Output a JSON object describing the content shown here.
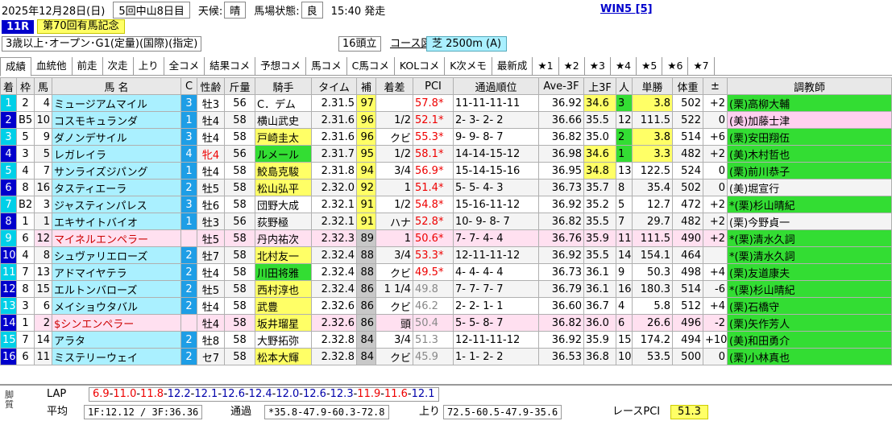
{
  "header": {
    "date": "2025年12月28日(日)",
    "meeting": "5回中山8日目",
    "weather_label": "天候:",
    "weather": "晴",
    "track_label": "馬場状態:",
    "track": "良",
    "start": "15:40 発走",
    "win5": "WIN5 [5]",
    "race_no": "11R",
    "race_name": "第70回有馬記念",
    "condition": "3歳以上･オープン･G1(定量)(国際)(指定)",
    "heads": "16頭立",
    "course_map": "コース図",
    "distance": "芝 2500m (A)"
  },
  "tabs": [
    "成績",
    "血統他",
    "前走",
    "次走",
    "上り",
    "全コメ",
    "結果コメ",
    "予想コメ",
    "馬コメ",
    "C馬コメ",
    "KOLコメ",
    "K次メモ",
    "最新成",
    "★1",
    "★2",
    "★3",
    "★4",
    "★5",
    "★6",
    "★7"
  ],
  "columns": [
    "着",
    "枠",
    "馬",
    "馬 名",
    "C",
    "性齢",
    "斤量",
    "騎手",
    "タイム",
    "補",
    "着差",
    "PCI",
    "通過順位",
    "Ave-3F",
    "上3F",
    "人",
    "単勝",
    "体重",
    "±",
    "調教師"
  ],
  "rows": [
    {
      "pos": "1",
      "waku": "2",
      "no": "4",
      "name": "ミュージアムマイル",
      "c": "3",
      "sa": "牡3",
      "kin": "56",
      "jockey": "C．デム",
      "time": "2.31.5",
      "ho": "97",
      "diff": "",
      "pci": "57.8*",
      "pass": "11-11-11-11",
      "ave": "36.92",
      "f3": "34.6",
      "pop": "3",
      "odds": "3.8",
      "wt": "502",
      "pm": "+2",
      "trainer": "(栗)高柳大輔"
    },
    {
      "pos": "2",
      "waku": "B5",
      "no": "10",
      "name": "コスモキュランダ",
      "c": "1",
      "sa": "牡4",
      "kin": "58",
      "jockey": "横山武史",
      "time": "2.31.6",
      "ho": "96",
      "diff": "1/2",
      "pci": "52.1*",
      "pass": "2- 3- 2- 2",
      "ave": "36.66",
      "f3": "35.5",
      "pop": "12",
      "odds": "111.5",
      "wt": "522",
      "pm": "0",
      "trainer": "(美)加藤士津"
    },
    {
      "pos": "3",
      "waku": "5",
      "no": "9",
      "name": "ダノンデサイル",
      "c": "3",
      "sa": "牡4",
      "kin": "58",
      "jockey": "戸崎圭太",
      "time": "2.31.6",
      "ho": "96",
      "diff": "クビ",
      "pci": "55.3*",
      "pass": "9- 9- 8- 7",
      "ave": "36.82",
      "f3": "35.0",
      "pop": "2",
      "odds": "3.8",
      "wt": "514",
      "pm": "+6",
      "trainer": "(栗)安田翔伍"
    },
    {
      "pos": "4",
      "waku": "3",
      "no": "5",
      "name": "レガレイラ",
      "c": "4",
      "sa": "牝4",
      "kin": "56",
      "jockey": "ルメール",
      "time": "2.31.7",
      "ho": "95",
      "diff": "1/2",
      "pci": "58.1*",
      "pass": "14-14-15-12",
      "ave": "36.98",
      "f3": "34.6",
      "pop": "1",
      "odds": "3.3",
      "wt": "482",
      "pm": "+2",
      "trainer": "(美)木村哲也"
    },
    {
      "pos": "5",
      "waku": "4",
      "no": "7",
      "name": "サンライズジパング",
      "c": "1",
      "sa": "牡4",
      "kin": "58",
      "jockey": "鮫島克駿",
      "time": "2.31.8",
      "ho": "94",
      "diff": "3/4",
      "pci": "56.9*",
      "pass": "15-14-15-16",
      "ave": "36.95",
      "f3": "34.8",
      "pop": "13",
      "odds": "122.5",
      "wt": "524",
      "pm": "0",
      "trainer": "(栗)前川恭子"
    },
    {
      "pos": "6",
      "waku": "8",
      "no": "16",
      "name": "タスティエーラ",
      "c": "2",
      "sa": "牡5",
      "kin": "58",
      "jockey": "松山弘平",
      "time": "2.32.0",
      "ho": "92",
      "diff": "1",
      "pci": "51.4*",
      "pass": "5- 5- 4- 3",
      "ave": "36.73",
      "f3": "35.7",
      "pop": "8",
      "odds": "35.4",
      "wt": "502",
      "pm": "0",
      "trainer": "(美)堀宣行"
    },
    {
      "pos": "7",
      "waku": "B2",
      "no": "3",
      "name": "ジャスティンパレス",
      "c": "3",
      "sa": "牡6",
      "kin": "58",
      "jockey": "団野大成",
      "time": "2.32.1",
      "ho": "91",
      "diff": "1/2",
      "pci": "54.8*",
      "pass": "15-16-11-12",
      "ave": "36.92",
      "f3": "35.2",
      "pop": "5",
      "odds": "12.7",
      "wt": "472",
      "pm": "+2",
      "trainer": "*(栗)杉山晴紀"
    },
    {
      "pos": "8",
      "waku": "1",
      "no": "1",
      "name": "エキサイトバイオ",
      "c": "1",
      "sa": "牡3",
      "kin": "56",
      "jockey": "荻野極",
      "time": "2.32.1",
      "ho": "91",
      "diff": "ハナ",
      "pci": "52.8*",
      "pass": "10- 9- 8- 7",
      "ave": "36.82",
      "f3": "35.5",
      "pop": "7",
      "odds": "29.7",
      "wt": "482",
      "pm": "+2",
      "trainer": "(栗)今野貞一"
    },
    {
      "pos": "9",
      "waku": "6",
      "no": "12",
      "name": "マイネルエンペラー",
      "c": "",
      "sa": "牡5",
      "kin": "58",
      "jockey": "丹内祐次",
      "time": "2.32.3",
      "ho": "89",
      "diff": "1",
      "pci": "50.6*",
      "pass": "7- 7- 4- 4",
      "ave": "36.76",
      "f3": "35.9",
      "pop": "11",
      "odds": "111.5",
      "wt": "490",
      "pm": "+2",
      "trainer": "*(栗)清水久詞"
    },
    {
      "pos": "10",
      "waku": "4",
      "no": "8",
      "name": "シュヴァリエローズ",
      "c": "2",
      "sa": "牡7",
      "kin": "58",
      "jockey": "北村友一",
      "time": "2.32.4",
      "ho": "88",
      "diff": "3/4",
      "pci": "53.3*",
      "pass": "12-11-11-12",
      "ave": "36.92",
      "f3": "35.5",
      "pop": "14",
      "odds": "154.1",
      "wt": "464",
      "pm": "",
      "trainer": "*(栗)清水久詞"
    },
    {
      "pos": "11",
      "waku": "7",
      "no": "13",
      "name": "アドマイヤテラ",
      "c": "2",
      "sa": "牡4",
      "kin": "58",
      "jockey": "川田将雅",
      "time": "2.32.4",
      "ho": "88",
      "diff": "クビ",
      "pci": "49.5*",
      "pass": "4- 4- 4- 4",
      "ave": "36.73",
      "f3": "36.1",
      "pop": "9",
      "odds": "50.3",
      "wt": "498",
      "pm": "+4",
      "trainer": "(栗)友道康夫"
    },
    {
      "pos": "12",
      "waku": "8",
      "no": "15",
      "name": "エルトンバローズ",
      "c": "2",
      "sa": "牡5",
      "kin": "58",
      "jockey": "西村淳也",
      "time": "2.32.4",
      "ho": "86",
      "diff": "1 1/4",
      "pci": "49.8",
      "pass": "7- 7- 7- 7",
      "ave": "36.79",
      "f3": "36.1",
      "pop": "16",
      "odds": "180.3",
      "wt": "514",
      "pm": "-6",
      "trainer": "*(栗)杉山晴紀"
    },
    {
      "pos": "13",
      "waku": "3",
      "no": "6",
      "name": "メイショウタバル",
      "c": "2",
      "sa": "牡4",
      "kin": "58",
      "jockey": "武豊",
      "time": "2.32.6",
      "ho": "86",
      "diff": "クビ",
      "pci": "46.2",
      "pass": "2- 2- 1- 1",
      "ave": "36.60",
      "f3": "36.7",
      "pop": "4",
      "odds": "5.8",
      "wt": "512",
      "pm": "+4",
      "trainer": "(栗)石橋守"
    },
    {
      "pos": "14",
      "waku": "1",
      "no": "2",
      "name": "$シンエンペラー",
      "c": "",
      "sa": "牡4",
      "kin": "58",
      "jockey": "坂井瑠星",
      "time": "2.32.6",
      "ho": "86",
      "diff": "頭",
      "pci": "50.4",
      "pass": "5- 5- 8- 7",
      "ave": "36.82",
      "f3": "36.0",
      "pop": "6",
      "odds": "26.6",
      "wt": "496",
      "pm": "-2",
      "trainer": "(栗)矢作芳人"
    },
    {
      "pos": "15",
      "waku": "7",
      "no": "14",
      "name": "アラタ",
      "c": "2",
      "sa": "牡8",
      "kin": "58",
      "jockey": "大野拓弥",
      "time": "2.32.8",
      "ho": "84",
      "diff": "3/4",
      "pci": "51.3",
      "pass": "12-11-11-12",
      "ave": "36.92",
      "f3": "35.9",
      "pop": "15",
      "odds": "174.2",
      "wt": "494",
      "pm": "+10",
      "trainer": "(美)和田勇介"
    },
    {
      "pos": "16",
      "waku": "6",
      "no": "11",
      "name": "ミステリーウェイ",
      "c": "2",
      "sa": "セ7",
      "kin": "58",
      "jockey": "松本大輝",
      "time": "2.32.8",
      "ho": "84",
      "diff": "クビ",
      "pci": "45.9",
      "pass": "1- 1- 2- 2",
      "ave": "36.53",
      "f3": "36.8",
      "pop": "10",
      "odds": "53.5",
      "wt": "500",
      "pm": "0",
      "trainer": "(栗)小林真也"
    }
  ],
  "lap": {
    "side_label": "脚質",
    "lap_label": "LAP",
    "laps": [
      "6.9",
      "11.0",
      "11.8",
      "12.2",
      "12.1",
      "12.6",
      "12.4",
      "12.0",
      "12.6",
      "12.3",
      "11.9",
      "11.6",
      "12.1"
    ],
    "avg_label": "平均",
    "avg_value": "1F:12.12 / 3F:36.36",
    "tsuka_label": "通過",
    "tsuka_value": "*35.8-47.9-60.3-72.8",
    "agari_label": "上り",
    "agari_value": "72.5-60.5-47.9-35.6",
    "rpci_label": "レースPCI",
    "rpci_value": "51.3"
  },
  "colors": {
    "pos_cyan": "#00d0e8",
    "pos_blue": "#0000cc",
    "row_pink": "#ffe0f0",
    "yellow": "#ffff66",
    "green": "#33dd33",
    "gray": "#c8c8c8",
    "waku": {
      "1": "#ffffff",
      "2": "#000000",
      "3": "#ff0000",
      "4": "#0000ff",
      "5": "#ffff00",
      "6": "#00aa00",
      "7": "#ff8800",
      "8": "#ff88cc"
    }
  }
}
